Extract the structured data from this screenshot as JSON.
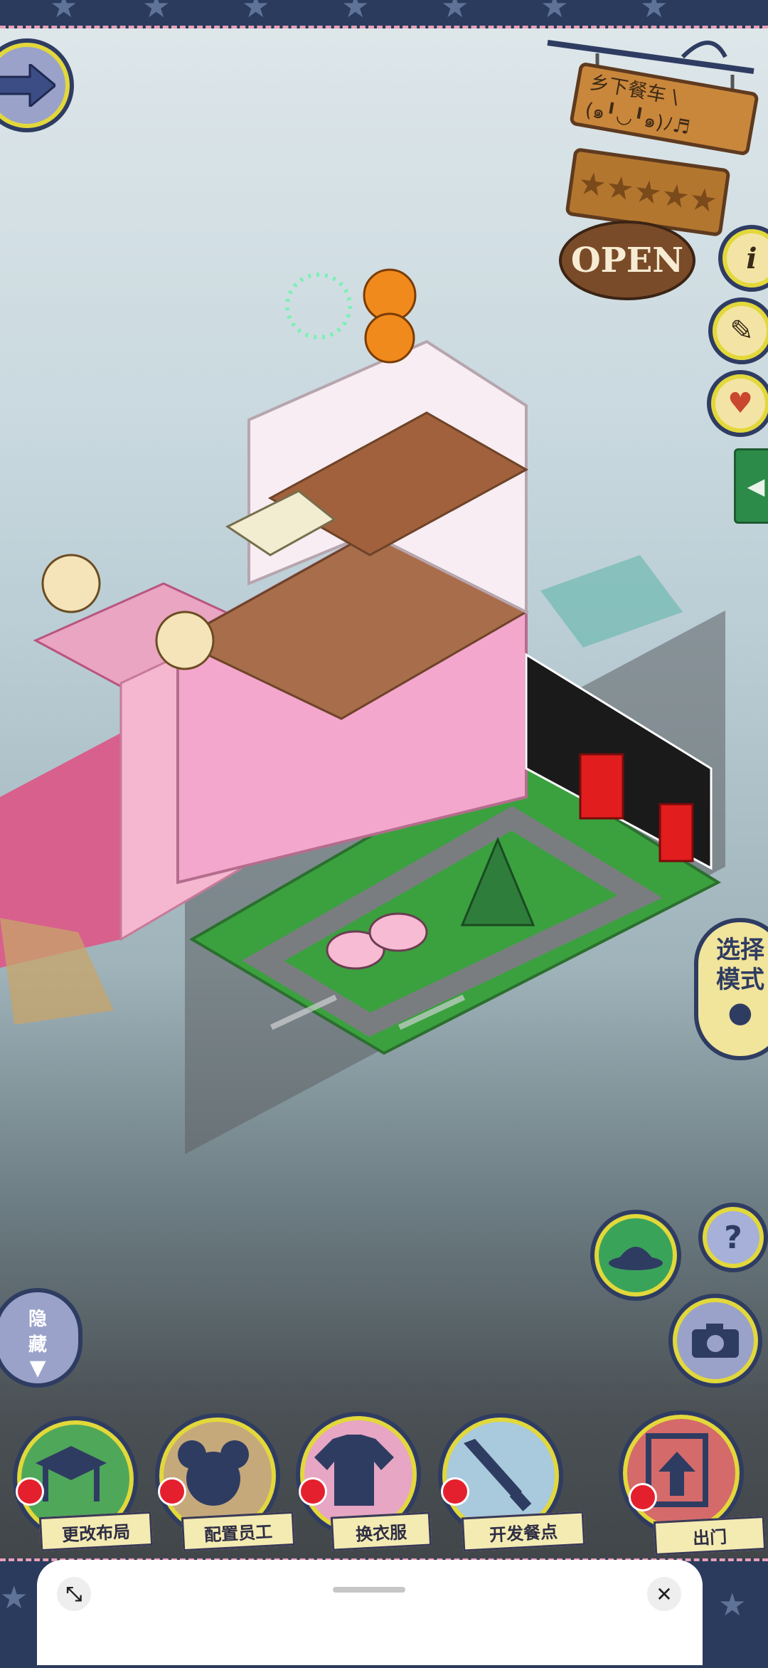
{
  "sign": {
    "shop_name": "乡下餐车 \\(๑╹◡╹๑)ﾉ♬",
    "stars": "★★★★★",
    "open_label": "OPEN"
  },
  "side_buttons": {
    "info": "i",
    "book": "✎",
    "heart": "♥",
    "help": "?",
    "mode_line1": "选择",
    "mode_line2": "模式"
  },
  "hide_button": {
    "line1": "隐",
    "line2": "藏"
  },
  "actions": [
    {
      "label": "更改布局",
      "color": "#4fa75a"
    },
    {
      "label": "配置员工",
      "color": "#c6a97b"
    },
    {
      "label": "换衣服",
      "color": "#e6a6c4"
    },
    {
      "label": "开发餐点",
      "color": "#a9c9dd"
    },
    {
      "label": "出门",
      "color": "#d56a6a"
    }
  ],
  "sheet": {
    "expand_icon": "⤡",
    "close_icon": "✕"
  },
  "colors": {
    "navy": "#2f3c62",
    "yellow_ring": "#e2d83a",
    "pink": "#e8a2c5",
    "grass": "#3aa13e"
  }
}
